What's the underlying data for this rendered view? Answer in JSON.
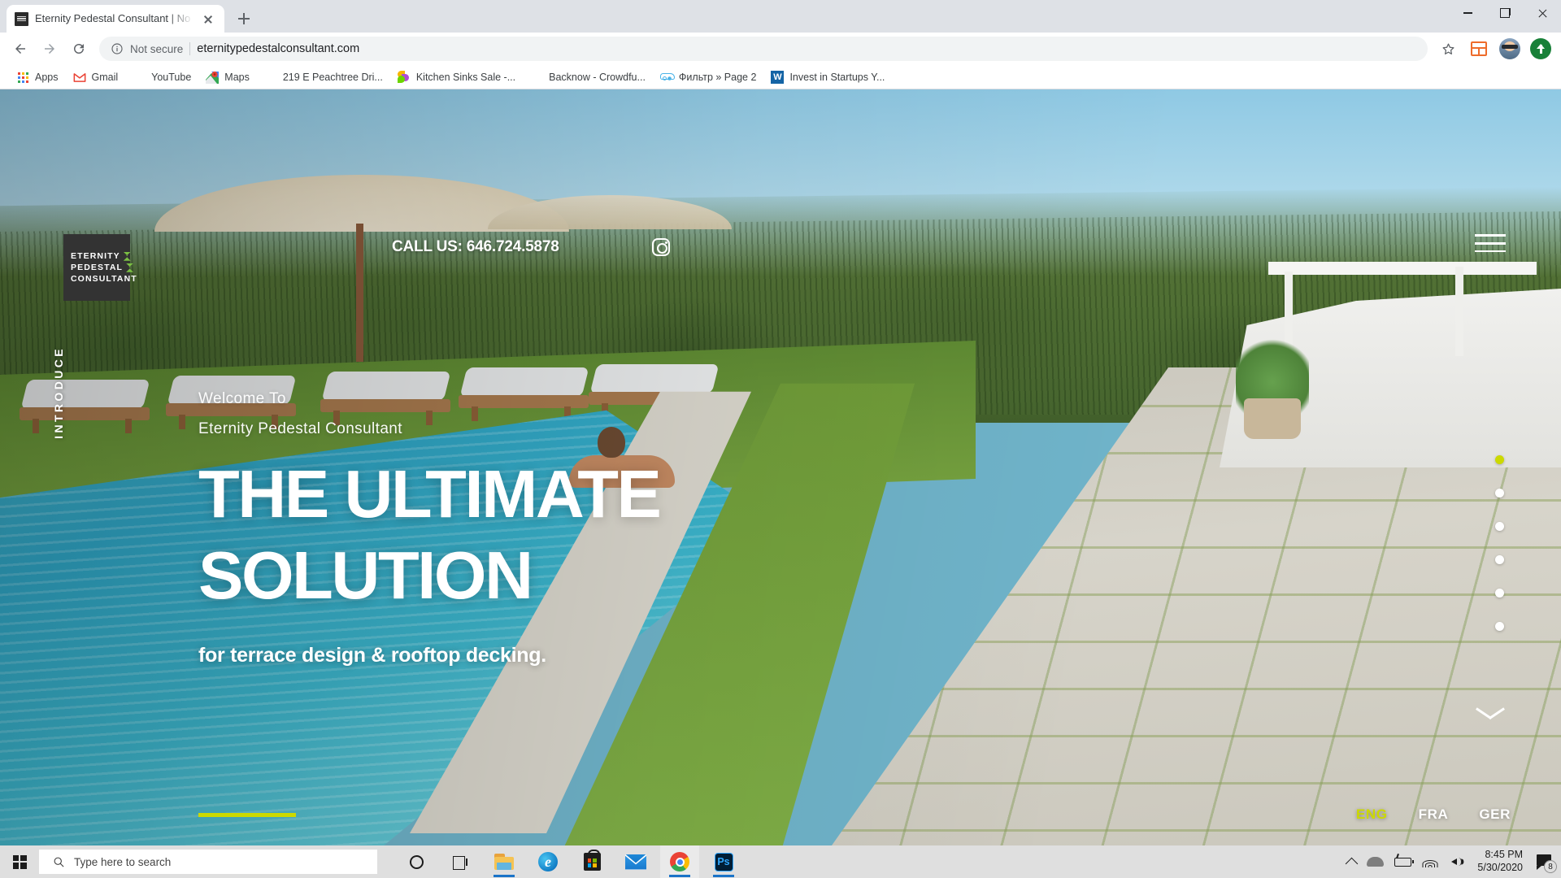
{
  "browser": {
    "tab": {
      "title": "Eternity Pedestal Consultant | No",
      "favicon": "site-logo-favicon"
    },
    "newtab_tooltip": "New tab",
    "window_controls": {
      "minimize": "minimize-icon",
      "maximize": "maximize-icon",
      "close": "close-icon"
    },
    "omnibox": {
      "security_label": "Not secure",
      "url": "eternitypedestalconsultant.com",
      "info_icon": "info-circle-icon"
    },
    "toolbar_icons": {
      "back": "back-arrow-icon",
      "forward": "forward-arrow-icon",
      "reload": "reload-icon",
      "bookmark_star": "star-icon",
      "extension": "extension-icon",
      "profile": "profile-avatar",
      "update": "update-arrow-icon"
    },
    "bookmarks": [
      {
        "label": "Apps",
        "icon": "apps-grid-icon"
      },
      {
        "label": "Gmail",
        "icon": "gmail-icon"
      },
      {
        "label": "YouTube",
        "icon": "youtube-icon"
      },
      {
        "label": "Maps",
        "icon": "maps-pin-icon"
      },
      {
        "label": "219 E Peachtree Dri...",
        "icon": "house-icon"
      },
      {
        "label": "Kitchen Sinks Sale -...",
        "icon": "petals-icon"
      },
      {
        "label": "Backnow - Crowdfu...",
        "icon": "photo-thumb-icon"
      },
      {
        "label": "Фильтр » Page 2",
        "icon": "car-icon"
      },
      {
        "label": "Invest in Startups Y...",
        "icon": "wefunder-icon"
      }
    ]
  },
  "site": {
    "logo": {
      "line1": "ETERNITY",
      "line2": "PEDESTAL",
      "line3": "CONSULTANT"
    },
    "call_us": "CALL US: 646.724.5878",
    "instagram": "instagram-icon",
    "menu": "hamburger-menu-icon",
    "vertical_label": "INTRODUCE",
    "hero": {
      "welcome_line1": "Welcome To",
      "welcome_line2": "Eternity Pedestal Consultant",
      "headline_line1": "THE ULTIMATE",
      "headline_line2": "SOLUTION",
      "tagline": "for terrace design & rooftop decking."
    },
    "slider": {
      "total_dots": 6,
      "active_index": 0,
      "accent_color": "#ccd900"
    },
    "scroll_hint": "chevron-down-icon",
    "languages": [
      {
        "label": "ENG",
        "active": true
      },
      {
        "label": "FRA",
        "active": false
      },
      {
        "label": "GER",
        "active": false
      }
    ]
  },
  "taskbar": {
    "start": "windows-logo-icon",
    "search_placeholder": "Type here to search",
    "cortana": "cortana-circle-icon",
    "task_view": "task-view-icon",
    "apps": [
      {
        "name": "file-explorer",
        "running": true
      },
      {
        "name": "microsoft-edge",
        "running": false
      },
      {
        "name": "microsoft-store",
        "running": false
      },
      {
        "name": "mail",
        "running": false
      },
      {
        "name": "google-chrome",
        "running": true,
        "active": true
      },
      {
        "name": "adobe-photoshop",
        "running": true
      }
    ],
    "tray": {
      "chevron": "show-hidden-icons",
      "onedrive": "onedrive-cloud-icon",
      "battery": "battery-icon",
      "wifi": "wifi-icon",
      "volume": "volume-icon",
      "time": "8:45 PM",
      "date": "5/30/2020",
      "notifications_count": "8"
    }
  }
}
